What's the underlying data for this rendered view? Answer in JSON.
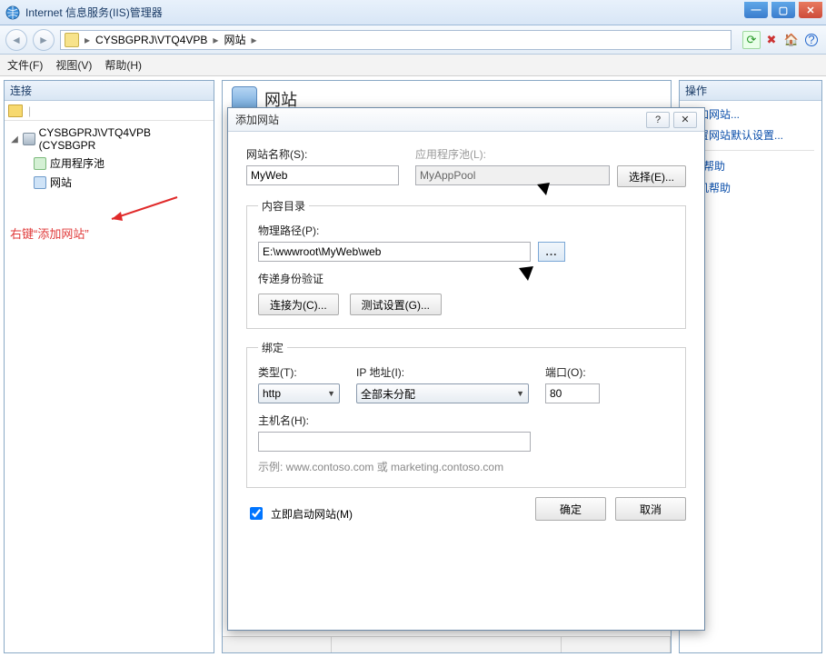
{
  "window": {
    "title": "Internet 信息服务(IIS)管理器"
  },
  "breadcrumb": {
    "server": "CYSBGPRJ\\VTQ4VPB",
    "node": "网站"
  },
  "menubar": {
    "file": "文件(F)",
    "view": "视图(V)",
    "help": "帮助(H)"
  },
  "left": {
    "header": "连接",
    "server": "CYSBGPRJ\\VTQ4VPB (CYSBGPR",
    "app_pools": "应用程序池",
    "sites": "网站",
    "annotation": "右键“添加网站”"
  },
  "center": {
    "title": "网站"
  },
  "right": {
    "header": "操作",
    "add_site": "添加网站...",
    "set_defaults": "设置网站默认设置...",
    "help": "帮助",
    "online_help": "联机帮助"
  },
  "dialog": {
    "title": "添加网站",
    "site_name_lbl": "网站名称(S):",
    "site_name_val": "MyWeb",
    "app_pool_lbl": "应用程序池(L):",
    "app_pool_val": "MyAppPool",
    "select_btn": "选择(E)...",
    "content_legend": "内容目录",
    "phys_path_lbl": "物理路径(P):",
    "phys_path_val": "E:\\wwwroot\\MyWeb\\web",
    "browse_btn": "...",
    "passthru_lbl": "传递身份验证",
    "connect_as_btn": "连接为(C)...",
    "test_btn": "测试设置(G)...",
    "binding_legend": "绑定",
    "type_lbl": "类型(T):",
    "type_val": "http",
    "ip_lbl": "IP 地址(I):",
    "ip_val": "全部未分配",
    "port_lbl": "端口(O):",
    "port_val": "80",
    "host_lbl": "主机名(H):",
    "host_val": "",
    "example": "示例: www.contoso.com 或 marketing.contoso.com",
    "start_now": "立即启动网站(M)",
    "ok": "确定",
    "cancel": "取消"
  }
}
